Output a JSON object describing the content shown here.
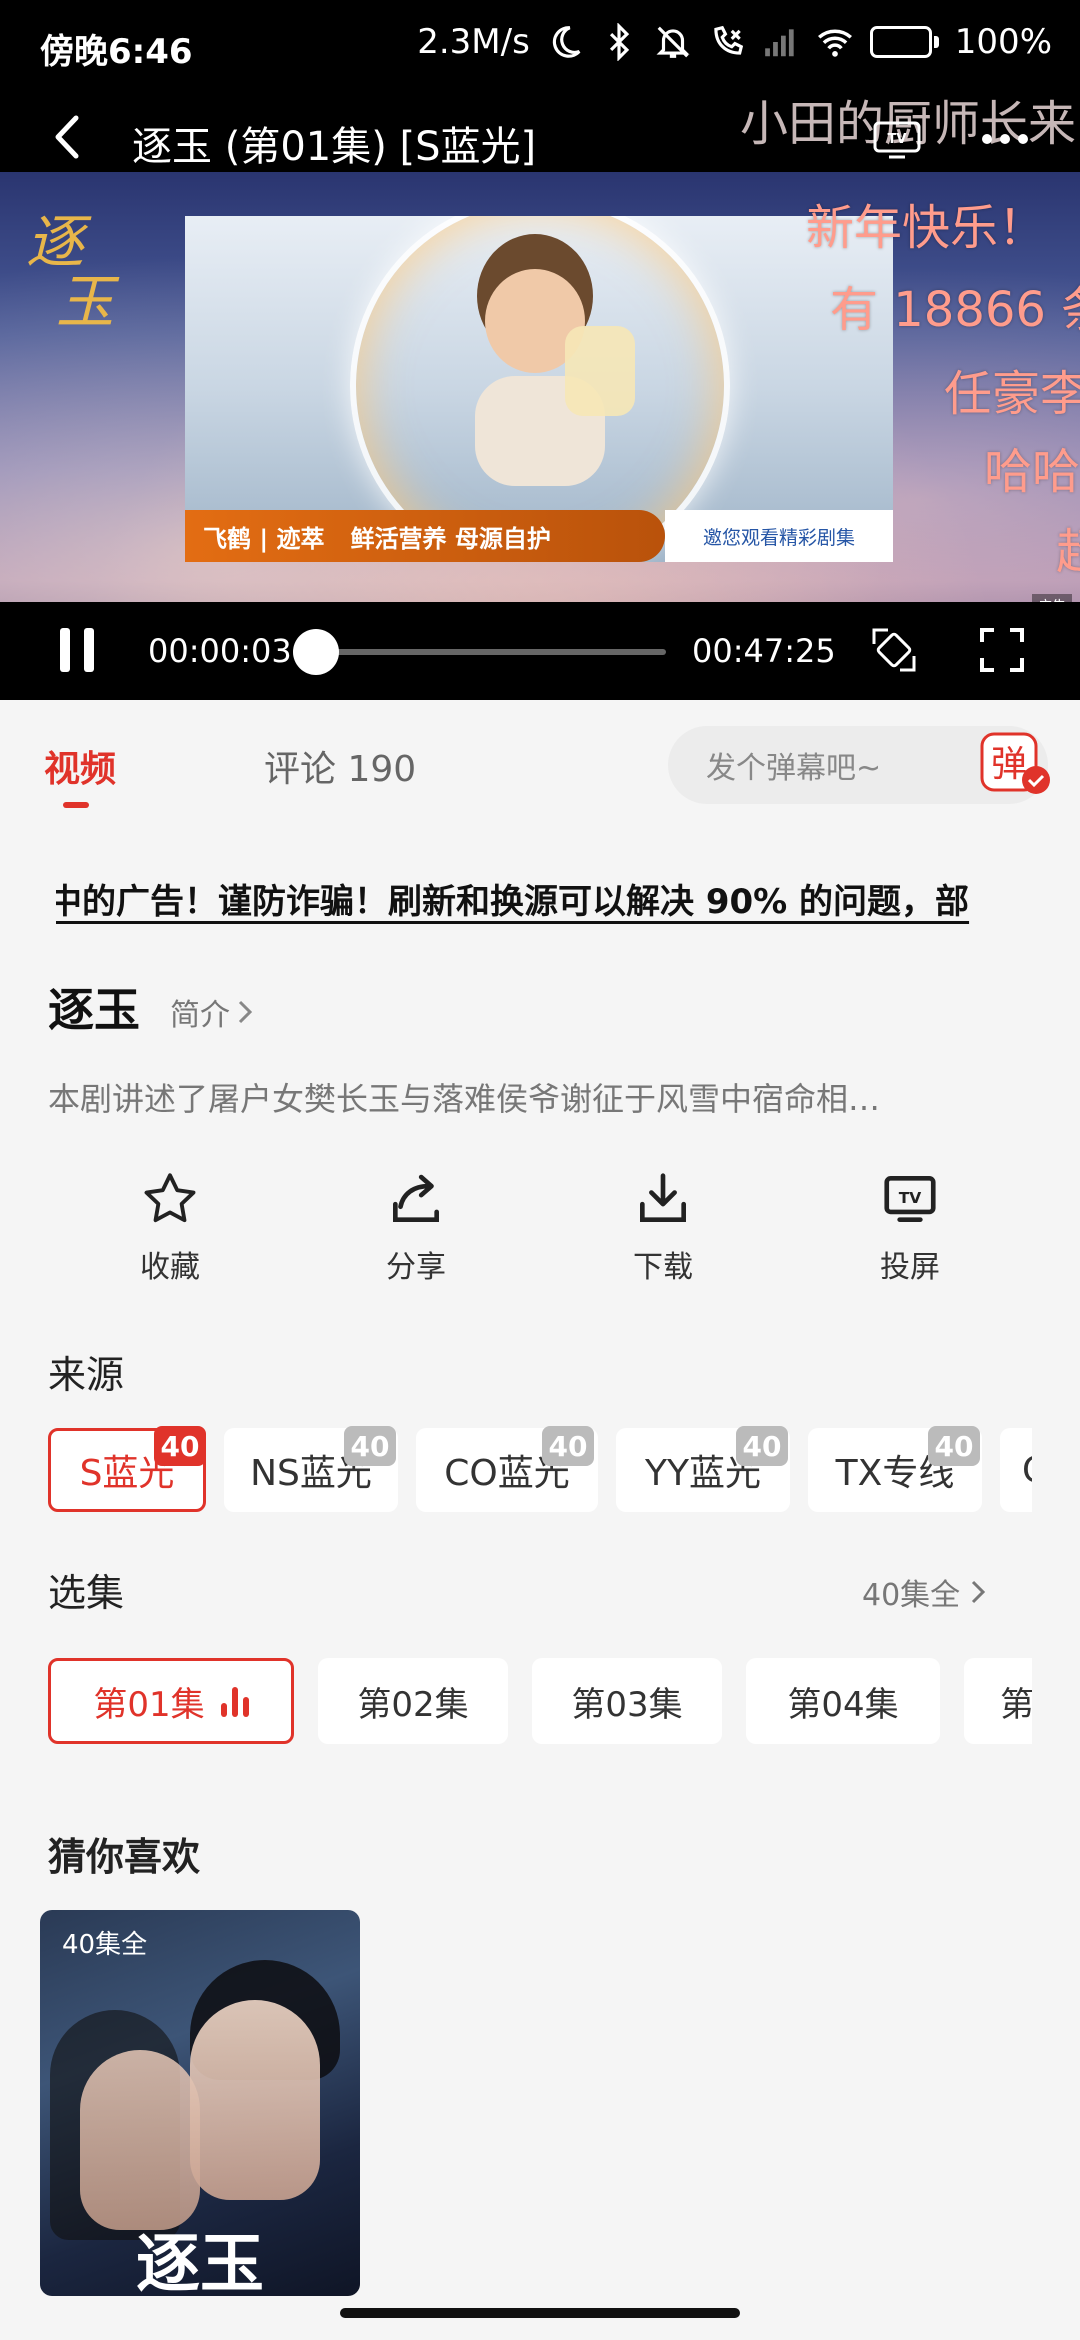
{
  "status_bar": {
    "time": "傍晚6:46",
    "net_speed": "2.3M/s",
    "battery": "100%",
    "battery_level": 1.0
  },
  "player": {
    "title": "逐玉 (第01集) [S蓝光]",
    "current_time": "00:00:03",
    "total_time": "00:47:25",
    "progress": 0.001,
    "ad_brand": "飞鹤 | 迹萃",
    "ad_slogan": "鲜活营养 母源自护",
    "ad_link": "邀您观看精彩剧集",
    "ad_tag": "广告",
    "danmaku": [
      "小田的厨师长来",
      "新年快乐！",
      "有 18866 条",
      "任豪李",
      "哈哈",
      "超"
    ]
  },
  "tabs": {
    "video": "视频",
    "comments": "评论 190",
    "danmaku_placeholder": "发个弹幕吧~",
    "danmaku_button": "弹"
  },
  "notice": "中的广告！谨防诈骗！刷新和换源可以解决 90% 的问题，部",
  "drama": {
    "title": "逐玉",
    "intro_label": "简介",
    "synopsis": "本剧讲述了屠户女樊长玉与落难侯爷谢征于风雪中宿命相…"
  },
  "actions": [
    {
      "label": "收藏",
      "icon": "star-icon"
    },
    {
      "label": "分享",
      "icon": "share-icon"
    },
    {
      "label": "下载",
      "icon": "download-icon"
    },
    {
      "label": "投屏",
      "icon": "tv-cast-icon"
    }
  ],
  "sources": {
    "title": "来源",
    "items": [
      {
        "label": "S蓝光",
        "count": "40",
        "active": true
      },
      {
        "label": "NS蓝光",
        "count": "40",
        "active": false
      },
      {
        "label": "CO蓝光",
        "count": "40",
        "active": false
      },
      {
        "label": "YY蓝光",
        "count": "40",
        "active": false
      },
      {
        "label": "TX专线",
        "count": "40",
        "active": false
      },
      {
        "label": "C",
        "count": "",
        "active": false
      }
    ]
  },
  "episodes": {
    "title": "选集",
    "total": "40集全",
    "items": [
      "第01集",
      "第02集",
      "第03集",
      "第04集",
      "第"
    ]
  },
  "recommend": {
    "title": "猜你喜欢",
    "items": [
      {
        "badge": "40集全",
        "logo": "逐玉"
      }
    ]
  },
  "colors": {
    "accent": "#e0332a",
    "danmaku": "#ff9c8c"
  }
}
